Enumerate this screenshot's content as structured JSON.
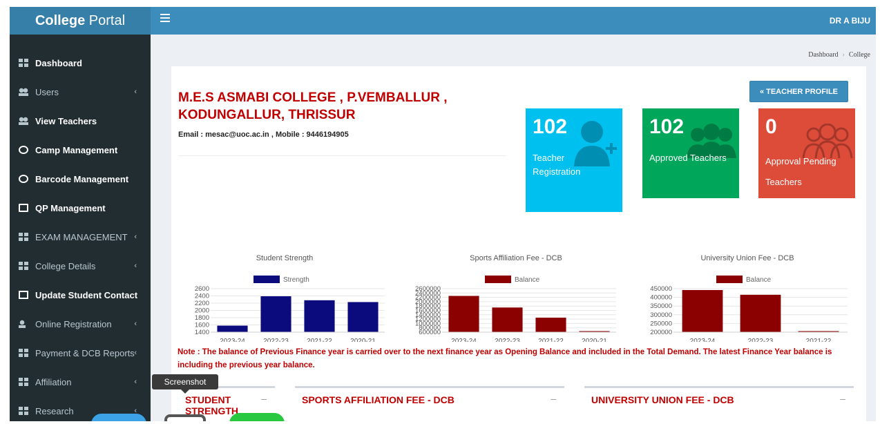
{
  "app": {
    "brand_bold": "College",
    "brand_light": " Portal",
    "user": "DR A BIJU"
  },
  "breadcrumb": {
    "home": "Dashboard",
    "sep": "›",
    "current": "College"
  },
  "sidebar": {
    "items": [
      {
        "label": "Dashboard",
        "icon": "dashboard-icon",
        "chevron": ""
      },
      {
        "label": "Users",
        "icon": "users-icon",
        "chevron": "‹"
      },
      {
        "label": "View Teachers",
        "icon": "users-icon",
        "chevron": ""
      },
      {
        "label": "Camp Management",
        "icon": "circle-arrow-icon",
        "chevron": ""
      },
      {
        "label": "Barcode Management",
        "icon": "circle-arrow-icon",
        "chevron": ""
      },
      {
        "label": "QP Management",
        "icon": "monitor-icon",
        "chevron": ""
      },
      {
        "label": "EXAM MANAGEMENT",
        "icon": "grid-icon",
        "chevron": "‹"
      },
      {
        "label": "College Details",
        "icon": "grid-icon",
        "chevron": "‹"
      },
      {
        "label": "Update Student Contact",
        "icon": "square-icon",
        "chevron": ""
      },
      {
        "label": "Online Registration",
        "icon": "user-plus-icon",
        "chevron": "‹"
      },
      {
        "label": "Payment & DCB Reports",
        "icon": "grid-icon",
        "chevron": "‹"
      },
      {
        "label": "Affiliation",
        "icon": "grid-icon",
        "chevron": "‹"
      },
      {
        "label": "Research",
        "icon": "grid-icon",
        "chevron": "‹"
      }
    ]
  },
  "college": {
    "name": "M.E.S ASMABI COLLEGE , P.VEMBALLUR , KODUNGALLUR, THRISSUR",
    "contact": "Email : mesac@uoc.ac.in , Mobile : 9446194905"
  },
  "teacher_profile_button": "« TEACHER PROFILE",
  "stat_boxes": [
    {
      "value": "102",
      "label": "Teacher Registration",
      "color": "#00c0ef"
    },
    {
      "value": "102",
      "label": "Approved Teachers",
      "color": "#00a65a"
    },
    {
      "value": "0",
      "label": "Approval Pending Teachers",
      "color": "#dd4b39"
    }
  ],
  "chart_data": [
    {
      "type": "bar",
      "title": "Student Strength",
      "categories": [
        "2023-24",
        "2022-23",
        "2021-22",
        "2020-21"
      ],
      "series": [
        {
          "name": "Strength",
          "values": [
            1580,
            2390,
            2280,
            2230
          ]
        }
      ],
      "ylim": [
        1400,
        2600
      ],
      "yticks": [
        "2600",
        "2400",
        "2200",
        "2000",
        "1800",
        "1600",
        "1400"
      ],
      "color": "#0b0b7d"
    },
    {
      "type": "bar",
      "title": "Sports Affiliation Fee - DCB",
      "categories": [
        "2023-24",
        "2022-23",
        "2021-22",
        "2020-21"
      ],
      "series": [
        {
          "name": "Balance",
          "values": [
            2300000,
            1820000,
            1400000,
            830000
          ]
        }
      ],
      "ylim": [
        800000,
        2600000
      ],
      "yticks": [
        "2600000",
        "2400000",
        "2200000",
        "2000000",
        "1800000",
        "1600000",
        "1400000",
        "1200000",
        "1000000",
        "800000",
        "600000"
      ],
      "color": "#8b0000"
    },
    {
      "type": "bar",
      "title": "University Union Fee - DCB",
      "categories": [
        "2023-24",
        "2022-23",
        "2021-22"
      ],
      "series": [
        {
          "name": "Balance",
          "values": [
            442000,
            415000,
            201000
          ]
        }
      ],
      "ylim": [
        200000,
        450000
      ],
      "yticks": [
        "450000",
        "400000",
        "350000",
        "300000",
        "250000",
        "200000"
      ],
      "color": "#8b0000"
    }
  ],
  "note": "Note : The balance of Previous Finance year is carried over to the next finance year as Opening Balance and included in the Total Demand. The latest Finance Year balance is including the previous year balance.",
  "sections": [
    {
      "title": "STUDENT STRENGTH",
      "toggle": "–"
    },
    {
      "title": "SPORTS AFFILIATION FEE - DCB",
      "toggle": "–"
    },
    {
      "title": "UNIVERSITY UNION FEE - DCB",
      "toggle": "–"
    }
  ],
  "tooltip": "Screenshot"
}
